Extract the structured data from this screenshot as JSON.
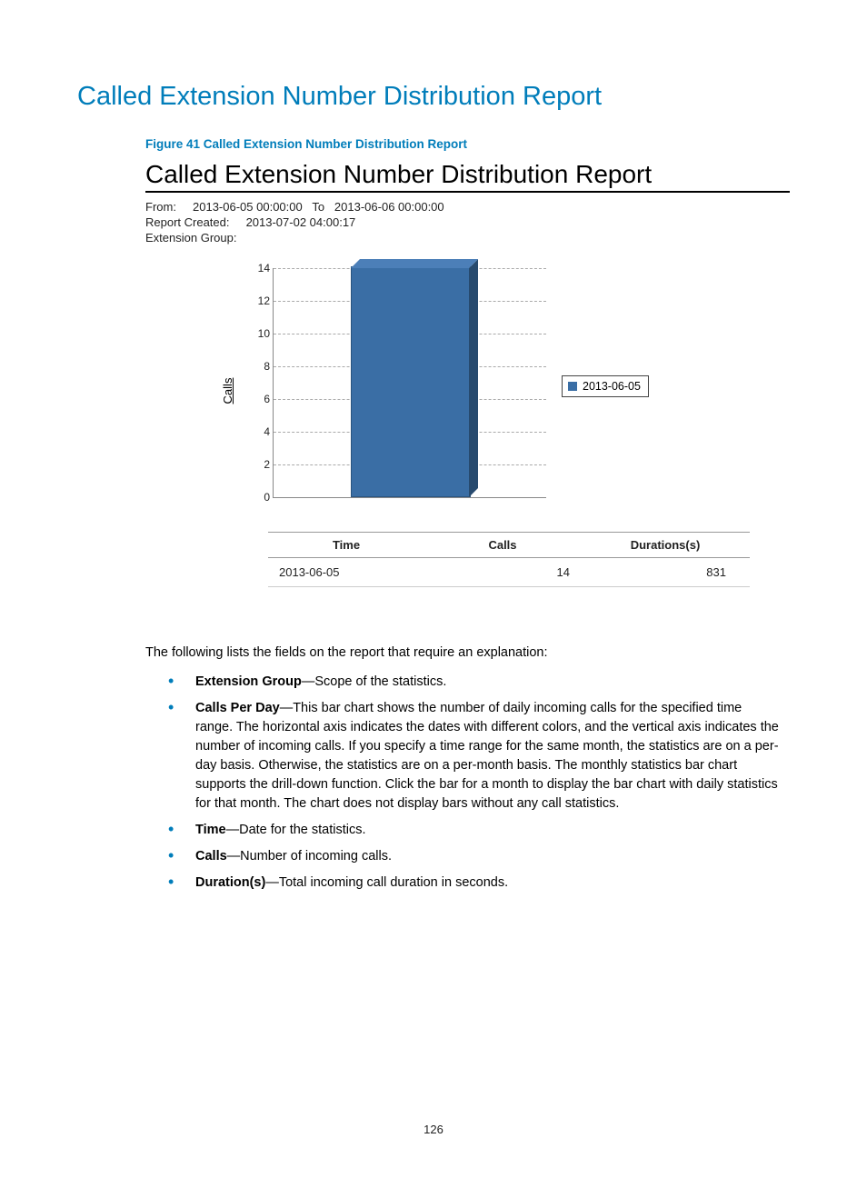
{
  "title": "Called Extension Number Distribution Report",
  "figure_caption": "Figure 41 Called Extension Number Distribution Report",
  "report": {
    "title": "Called Extension Number Distribution Report",
    "from_label": "From:",
    "from_value": "2013-06-05 00:00:00",
    "to_label": "To",
    "to_value": "2013-06-06 00:00:00",
    "created_label": "Report Created:",
    "created_value": "2013-07-02 04:00:17",
    "extgroup_label": "Extension Group:",
    "extgroup_value": ""
  },
  "chart": {
    "ylabel": "Calls",
    "legend": "2013-06-05"
  },
  "chart_data": {
    "type": "bar",
    "categories": [
      "2013-06-05"
    ],
    "values": [
      14
    ],
    "title": "",
    "xlabel": "",
    "ylabel": "Calls",
    "ylim": [
      0,
      14
    ],
    "yticks": [
      0,
      2,
      4,
      6,
      8,
      10,
      12,
      14
    ],
    "legend": [
      "2013-06-05"
    ]
  },
  "table": {
    "headers": [
      "Time",
      "Calls",
      "Durations(s)"
    ],
    "rows": [
      {
        "time": "2013-06-05",
        "calls": "14",
        "duration": "831"
      }
    ]
  },
  "explain": {
    "intro": "The following lists the fields on the report that require an explanation:",
    "items": [
      {
        "term": "Extension Group",
        "desc": "—Scope of the statistics."
      },
      {
        "term": "Calls Per Day",
        "desc": "—This bar chart shows the number of daily incoming calls for the specified time range. The horizontal axis indicates the dates with different colors, and the vertical axis indicates the number of incoming calls. If you specify a time range for the same month, the statistics are on a per-day basis. Otherwise, the statistics are on a per-month basis. The monthly statistics bar chart supports the drill-down function. Click the bar for a month to display the bar chart with daily statistics for that month. The chart does not display bars without any call statistics."
      },
      {
        "term": "Time",
        "desc": "—Date for the statistics."
      },
      {
        "term": "Calls",
        "desc": "—Number of incoming calls."
      },
      {
        "term": "Duration(s)",
        "desc": "—Total incoming call duration in seconds."
      }
    ]
  },
  "page_number": "126"
}
